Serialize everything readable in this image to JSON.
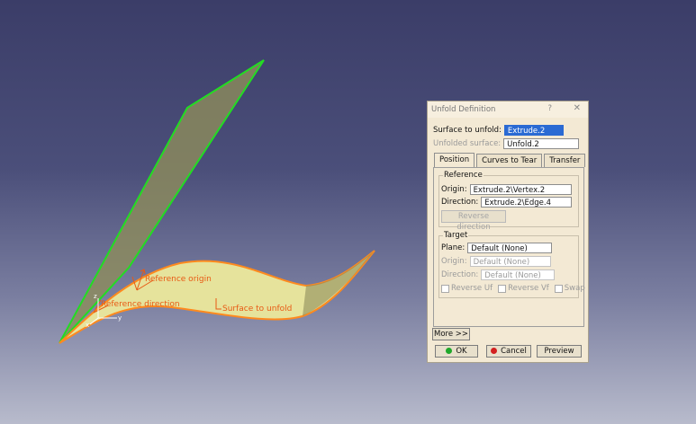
{
  "scene": {
    "labels": {
      "reference_origin": "Reference origin",
      "reference_direction": "Reference direction",
      "surface_to_unfold": "Surface to unfold",
      "axis_x": "x",
      "axis_y": "y",
      "axis_z": "z"
    }
  },
  "dialog": {
    "title": "Unfold Definition",
    "help": "?",
    "close": "✕",
    "surface_label": "Surface to unfold:",
    "surface_value": "Extrude.2",
    "unfolded_label": "Unfolded surface:",
    "unfolded_value": "Unfold.2",
    "tabs": [
      "Position",
      "Curves to Tear",
      "Transfer"
    ],
    "reference": {
      "title": "Reference",
      "origin_label": "Origin:",
      "origin_value": "Extrude.2\\Vertex.2",
      "direction_label": "Direction:",
      "direction_value": "Extrude.2\\Edge.4",
      "reverse_button": "Reverse direction"
    },
    "target": {
      "title": "Target",
      "plane_label": "Plane:",
      "plane_value": "Default (None)",
      "origin_label": "Origin:",
      "origin_value": "Default (None)",
      "direction_label": "Direction:",
      "direction_value": "Default (None)",
      "reverse_uf": "Reverse Uf",
      "reverse_vf": "Reverse Vf",
      "swap": "Swap"
    },
    "more_button": "More >>",
    "ok_button": "OK",
    "cancel_button": "Cancel",
    "preview_button": "Preview"
  },
  "colors": {
    "surface_fill": "#e6e39c",
    "plane_fill": "#8a8a5a",
    "edge_green": "#22dd22",
    "edge_orange": "#ff8a1e",
    "annotation": "#e85a14"
  }
}
